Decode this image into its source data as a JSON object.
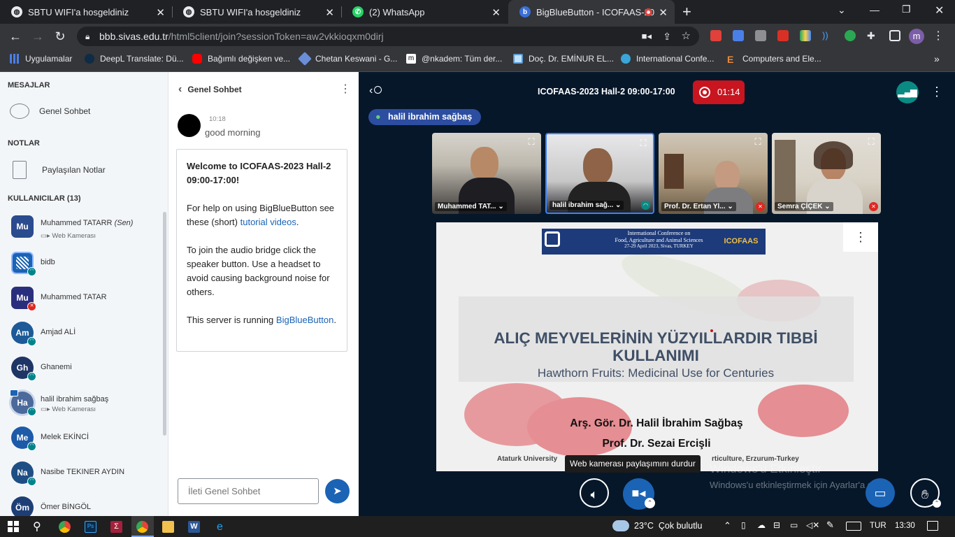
{
  "browser": {
    "tabs": [
      {
        "title": "SBTU WIFI'a hosgeldiniz",
        "icon": "globe-icon"
      },
      {
        "title": "SBTU WIFI'a hosgeldiniz",
        "icon": "globe-icon"
      },
      {
        "title": "(2) WhatsApp",
        "icon": "whatsapp-icon"
      },
      {
        "title": "BigBlueButton - ICOFAAS-20",
        "icon": "bigbluebutton-icon"
      }
    ],
    "url_host": "bbb.sivas.edu.tr",
    "url_path": "/html5client/join?sessionToken=aw2vkkioqxm0dirj",
    "bookmarks": [
      "Uygulamalar",
      "DeepL Translate: Dü...",
      "Bağımlı değişken ve...",
      "Chetan Keswani - G...",
      "@nkadem: Tüm der...",
      "Doç. Dr. EMİNUR EL...",
      "International Confe...",
      "Computers and Ele..."
    ],
    "profile_initial": "m"
  },
  "sidebar": {
    "messages_heading": "MESAJLAR",
    "public_chat": "Genel Sohbet",
    "notes_heading": "NOTLAR",
    "shared_notes": "Paylaşılan Notlar",
    "users_heading": "KULLANICILAR (13)",
    "users": [
      {
        "initials": "Mu",
        "name": "Muhammed TATARR",
        "you": "(Sen)",
        "sub": "Web Kamerası",
        "color": "#2b4b8f"
      },
      {
        "initials": "",
        "name": "bidb",
        "sub": "",
        "color": "#1b63b5"
      },
      {
        "initials": "Mu",
        "name": "Muhammed TATAR",
        "sub": "",
        "color": "#2a2f7d"
      },
      {
        "initials": "Am",
        "name": "Amjad ALİ",
        "sub": "",
        "color": "#1d5a97"
      },
      {
        "initials": "Gh",
        "name": "Ghanemi",
        "sub": "",
        "color": "#1f3566"
      },
      {
        "initials": "Ha",
        "name": "halil ibrahim sağbaş",
        "sub": "Web Kamerası",
        "color": "#4b6a9b"
      },
      {
        "initials": "Me",
        "name": "Melek EKİNCİ",
        "sub": "",
        "color": "#1d5aa8"
      },
      {
        "initials": "Na",
        "name": "Nasibe TEKINER AYDIN",
        "sub": "",
        "color": "#1e4f84"
      },
      {
        "initials": "Öm",
        "name": "Ömer BİNGÖL",
        "sub": "",
        "color": "#1e3f76"
      }
    ]
  },
  "chat": {
    "title": "Genel Sohbet",
    "message_time": "10:18",
    "message_text": "good morning",
    "welcome_line1": "Welcome to ICOFAAS-2023 Hall-2 09:00-17:00!",
    "help_prefix": "For help on using BigBlueButton see these (short)",
    "help_link": "tutorial videos",
    "audio_text": "To join the audio bridge click the speaker button. Use a headset to avoid causing background noise for others.",
    "server_prefix": "This server is running",
    "server_link": "BigBlueButton",
    "input_placeholder": "İleti Genel Sohbet"
  },
  "meeting": {
    "title": "ICOFAAS-2023 Hall-2 09:00-17:00",
    "recording_time": "01:14",
    "talker": "halil ibrahim sağbaş",
    "cameras": [
      {
        "name": "Muhammed TAT...",
        "muted": false
      },
      {
        "name": "halil ibrahim sağ...",
        "muted": false
      },
      {
        "name": "Prof. Dr. Ertan Yl...",
        "muted": true
      },
      {
        "name": "Semra ÇİÇEK",
        "muted": true
      }
    ],
    "tooltip": "Web kamerası paylaşımını durdur",
    "activation_title": "Windows'u Etkinleştir",
    "activation_sub": "Windows'u etkinleştirmek için Ayarlar'a gidin."
  },
  "slide": {
    "banner_line1": "International Conference on",
    "banner_line2": "Food, Agriculture and Animal Sciences",
    "banner_line3": "27-29 April 2023, Sivas, TURKEY",
    "banner_tag": "ICOFAAS",
    "title": "ALIÇ MEYVELERİNİN YÜZYILLARDIR TIBBİ KULLANIMI",
    "subtitle": "Hawthorn Fruits: Medicinal Use for Centuries",
    "author1": "Arş. Gör. Dr. Halil İbrahim Sağbaş",
    "author2": "Prof. Dr. Sezai Ercişli",
    "affil_left": "Ataturk University",
    "affil_right": "rticulture, Erzurum-Turkey"
  },
  "taskbar": {
    "weather_temp": "23°C",
    "weather_text": "Çok bulutlu",
    "language": "TUR",
    "time": "13:30"
  }
}
